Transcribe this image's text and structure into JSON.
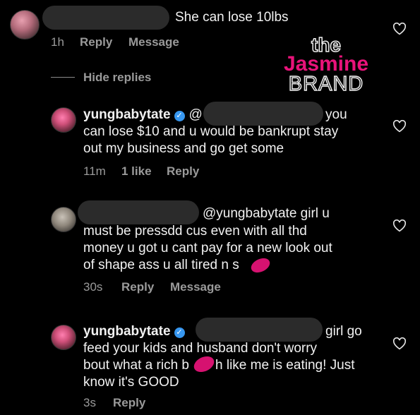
{
  "comment1": {
    "text": "She can lose 10lbs",
    "time": "1h",
    "reply": "Reply",
    "message": "Message"
  },
  "hide_replies": "Hide replies",
  "watermark": {
    "line1": "the",
    "line2": "Jasmine",
    "line3": "BRAND"
  },
  "reply1": {
    "username": "yungbabytate",
    "mention_prefix": "@",
    "lines": [
      "you",
      "can lose $10 and u would be bankrupt stay",
      "out my business and go get some"
    ],
    "time": "11m",
    "likes": "1 like",
    "reply": "Reply"
  },
  "reply2": {
    "lines": [
      "@yungbabytate girl u",
      "must be pressdd cus even with all thd",
      "money u got u cant pay for a new look out",
      "of shape ass u all tired n s"
    ],
    "time": "30s",
    "reply": "Reply",
    "message": "Message"
  },
  "reply3": {
    "username": "yungbabytate",
    "lines": [
      "girl go",
      "feed your kids and husband don't worry",
      "bout what a rich b",
      "h like me is eating! Just",
      "know it's GOOD"
    ],
    "time": "3s",
    "reply": "Reply"
  }
}
